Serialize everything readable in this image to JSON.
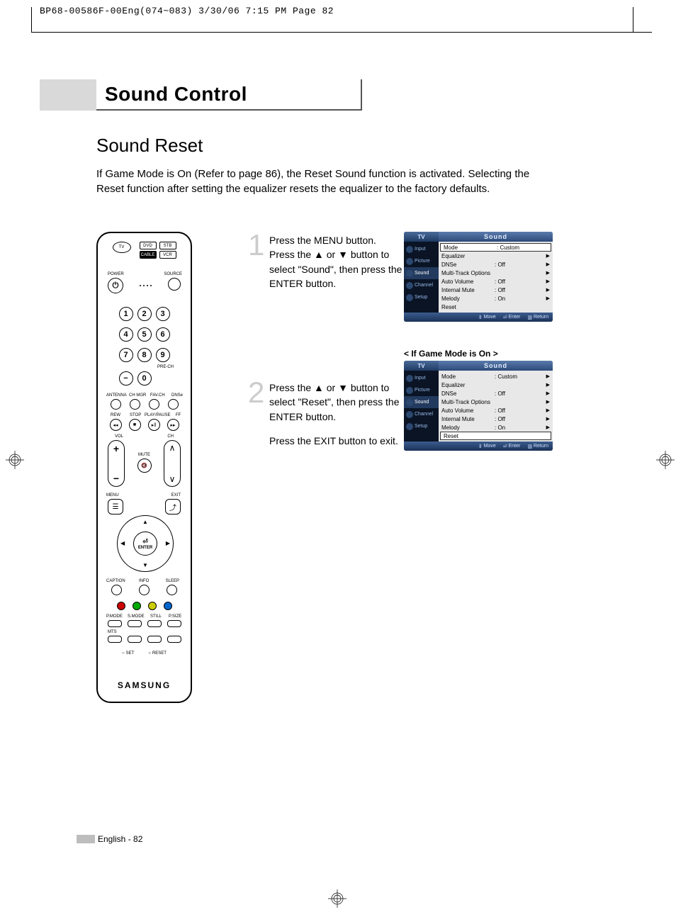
{
  "header": "BP68-00586F-00Eng(074~083)  3/30/06  7:15 PM  Page 82",
  "section_title": "Sound Control",
  "subheading": "Sound Reset",
  "intro": "If Game Mode is On (Refer to page 86), the Reset Sound function is activated. Selecting the Reset function after setting the equalizer resets the equalizer to the factory defaults.",
  "steps": [
    {
      "num": "1",
      "text": "Press the MENU button. Press the ▲ or ▼ button to select \"Sound\", then press the ENTER button."
    },
    {
      "num": "2",
      "text1": "Press the ▲ or ▼ button to select \"Reset\", then press the ENTER button.",
      "text2": "Press the EXIT button to exit."
    }
  ],
  "osd_caption": "< If Game Mode is On >",
  "osd": {
    "header_left": "TV",
    "header_right": "Sound",
    "side": [
      {
        "label": "Input"
      },
      {
        "label": "Picture"
      },
      {
        "label": "Sound",
        "active": true
      },
      {
        "label": "Channel"
      },
      {
        "label": "Setup"
      }
    ],
    "rows": [
      {
        "label": "Mode",
        "val": ": Custom",
        "arrow": true
      },
      {
        "label": "Equalizer",
        "val": "",
        "arrow": true
      },
      {
        "label": "DNSe",
        "val": ": Off",
        "arrow": true
      },
      {
        "label": "Multi-Track Options",
        "val": "",
        "arrow": true
      },
      {
        "label": "Auto Volume",
        "val": ": Off",
        "arrow": true
      },
      {
        "label": "Internal Mute",
        "val": ": Off",
        "arrow": true
      },
      {
        "label": "Melody",
        "val": ": On",
        "arrow": true
      },
      {
        "label": "Reset",
        "val": "",
        "arrow": false
      }
    ],
    "footer": {
      "move": "Move",
      "enter": "Enter",
      "ret": "Return"
    }
  },
  "remote": {
    "dev_top": [
      "DVD",
      "STB"
    ],
    "dev_bot": [
      "CABLE",
      "VCR"
    ],
    "tv": "TV",
    "power": "POWER",
    "source": "SOURCE",
    "numpad": [
      "1",
      "2",
      "3",
      "4",
      "5",
      "6",
      "7",
      "8",
      "9",
      "0"
    ],
    "dash": "−",
    "pre_ch": "PRE-CH",
    "row1": [
      "ANTENNA",
      "CH MGR",
      "FAV.CH",
      "DNSe"
    ],
    "row2": [
      "REW",
      "STOP",
      "PLAY/PAUSE",
      "FF"
    ],
    "vol": "VOL",
    "ch": "CH",
    "mute": "MUTE",
    "menu": "MENU",
    "exit": "EXIT",
    "enter": "ENTER",
    "row3": [
      "CAPTION",
      "INFO",
      "SLEEP"
    ],
    "row4": [
      "P.MODE",
      "S.MODE",
      "STILL",
      "P.SIZE"
    ],
    "mts": "MTS",
    "set": "SET",
    "reset": "RESET",
    "brand": "SAMSUNG"
  },
  "footer": "English - 82"
}
